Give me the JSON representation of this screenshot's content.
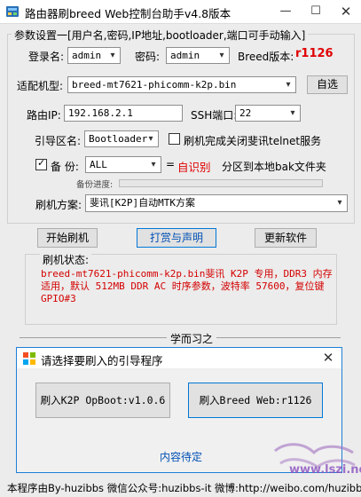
{
  "window": {
    "title": "路由器刷breed Web控制台助手v4.8版本",
    "min": "—",
    "max": "☐",
    "close": "✕"
  },
  "params": {
    "legend": "参数设置一[用户名,密码,IP地址,bootloader,端口可手动输入]",
    "username_label": "登录名:",
    "username": "admin",
    "password_label": "密码:",
    "password": "admin",
    "breed_version_label": "Breed版本:",
    "breed_version": "r1126",
    "model_label": "适配机型:",
    "model": "breed-mt7621-phicomm-k2p.bin",
    "auto_select": "自选",
    "ip_label": "路由IP:",
    "ip": "192.168.2.1",
    "ssh_label": "SSH端口:",
    "ssh_port": "22",
    "boot_label": "引导区名:",
    "boot": "Bootloader",
    "telnet_label": "刷机完成关闭斐讯telnet服务",
    "backup_label": "备 份:",
    "backup": "ALL",
    "eq": "=",
    "auto_detect": "自识别",
    "backup_desc": "分区到本地bak文件夹",
    "progress_label": "备份进度:",
    "progress": 0,
    "scheme_label": "刷机方案:",
    "scheme": "斐讯[K2P]自动MTK方案"
  },
  "actions": {
    "start": "开始刷机",
    "donate": "打赏与声明",
    "update": "更新软件"
  },
  "status": {
    "label": "刷机状态:",
    "text": "breed-mt7621-phicomm-k2p.bin斐讯 K2P 专用，DDR3 内存适用，默认 512MB DDR AC 时序参数，波特率 57600，复位键 GPIO#3"
  },
  "separator": "学而习之",
  "dialog": {
    "title": "请选择要刷入的引导程序",
    "close": "✕",
    "opboot": "刷入K2P OpBoot:v1.0.6",
    "breed": "刷入Breed Web:r1126",
    "pending": "内容待定"
  },
  "footer": "本程序由By-huzibbs 微信公众号:huzibbs-it 微博:http://weibo.com/huzibbs",
  "watermark": {
    "site": "www.lszi.net"
  },
  "colors": {
    "accent": "#0078d7",
    "status_red": "#d40000",
    "label_red": "#e00000"
  }
}
